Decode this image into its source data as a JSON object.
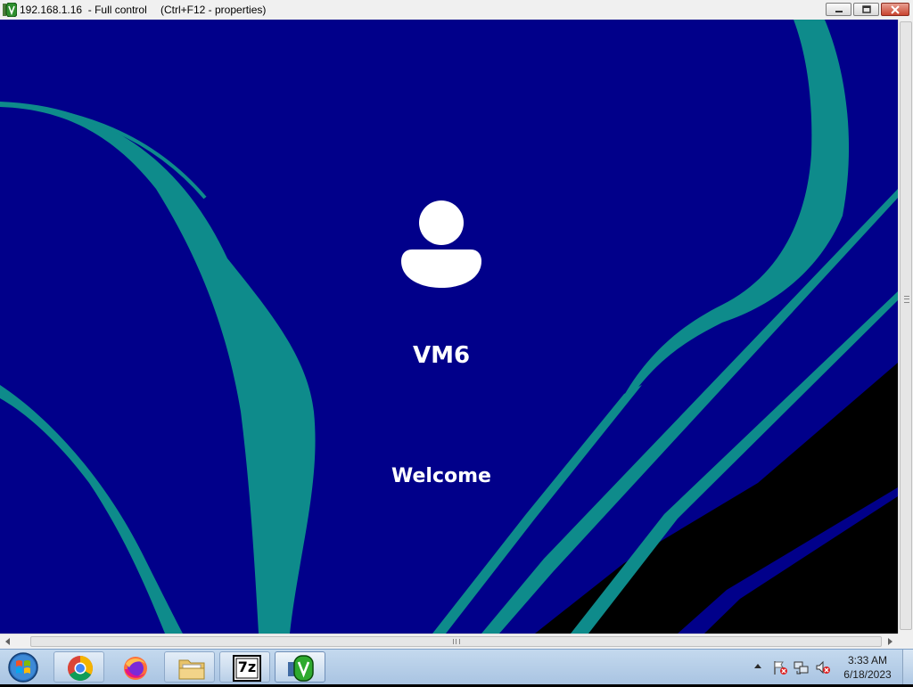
{
  "window": {
    "title": "192.168.1.16  - Full control",
    "hint": "(Ctrl+F12 - properties)",
    "app_icon": "remote-control-v-icon",
    "controls": [
      "minimize-icon",
      "maximize-icon",
      "close-icon"
    ]
  },
  "remote_screen": {
    "user_name": "VM6",
    "status": "Welcome",
    "avatar_icon": "user-silhouette-icon",
    "colors": {
      "background": "#01008a",
      "accent": "#0e8b8b",
      "shadow": "#000000"
    }
  },
  "taskbar": {
    "start_icon": "windows-logo-icon",
    "pinned": [
      {
        "name": "chrome",
        "icon": "chrome-icon"
      },
      {
        "name": "firefox",
        "icon": "firefox-icon"
      },
      {
        "name": "file-explorer",
        "icon": "folder-icon"
      },
      {
        "name": "7-zip",
        "icon": "7zip-icon",
        "label": "7z"
      },
      {
        "name": "remote-control",
        "icon": "remote-control-v-icon",
        "active": true
      }
    ],
    "tray": {
      "icons": [
        "show-hidden-icons-arrow",
        "action-center-flag-icon",
        "network-icon",
        "volume-muted-icon"
      ],
      "time": "3:33 AM",
      "date": "6/18/2023"
    }
  }
}
